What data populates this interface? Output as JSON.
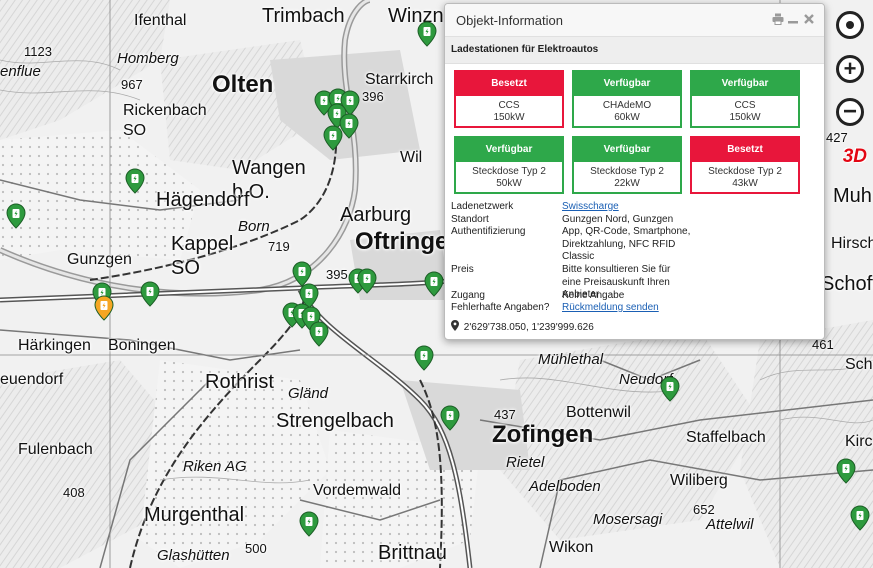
{
  "map": {
    "place_labels": [
      {
        "text": "Trimbach",
        "cls": "lbl-mid"
      },
      {
        "text": "Winzna",
        "cls": "lbl-mid"
      },
      {
        "text": "Ifenthal",
        "cls": "lbl-sm"
      },
      {
        "text": "Homberg",
        "cls": "lbl-it"
      },
      {
        "text": "Olten",
        "cls": "lbl-big"
      },
      {
        "text": "Starrkirch",
        "cls": "lbl-sm"
      },
      {
        "text": "Rickenbach SO",
        "cls": "lbl-sm"
      },
      {
        "text": "Wangen b.O.",
        "cls": "lbl-mid"
      },
      {
        "text": "Wil",
        "cls": "lbl-sm"
      },
      {
        "text": "Hägendorf",
        "cls": "lbl-mid"
      },
      {
        "text": "Aarburg",
        "cls": "lbl-mid"
      },
      {
        "text": "Oftringen",
        "cls": "lbl-big"
      },
      {
        "text": "Kappel SO",
        "cls": "lbl-mid"
      },
      {
        "text": "Born",
        "cls": "lbl-it"
      },
      {
        "text": "Gunzgen",
        "cls": "lbl-sm"
      },
      {
        "text": "Härkingen",
        "cls": "lbl-sm"
      },
      {
        "text": "Boningen",
        "cls": "lbl-sm"
      },
      {
        "text": "euendorf",
        "cls": "lbl-sm"
      },
      {
        "text": "Rothrist",
        "cls": "lbl-mid"
      },
      {
        "text": "Gländ",
        "cls": "lbl-it"
      },
      {
        "text": "Strengelbach",
        "cls": "lbl-mid"
      },
      {
        "text": "Mühlethal",
        "cls": "lbl-it"
      },
      {
        "text": "Neudorf",
        "cls": "lbl-it"
      },
      {
        "text": "Bottenwil",
        "cls": "lbl-sm"
      },
      {
        "text": "Zofingen",
        "cls": "lbl-big"
      },
      {
        "text": "Staffelbach",
        "cls": "lbl-sm"
      },
      {
        "text": "Fulenbach",
        "cls": "lbl-sm"
      },
      {
        "text": "Riken AG",
        "cls": "lbl-it"
      },
      {
        "text": "Rietel",
        "cls": "lbl-it"
      },
      {
        "text": "Adelboden",
        "cls": "lbl-it"
      },
      {
        "text": "Wiliberg",
        "cls": "lbl-sm"
      },
      {
        "text": "Murgenthal",
        "cls": "lbl-mid"
      },
      {
        "text": "Vordemwald",
        "cls": "lbl-sm"
      },
      {
        "text": "Mosersagi",
        "cls": "lbl-it"
      },
      {
        "text": "Attelwil",
        "cls": "lbl-it"
      },
      {
        "text": "Glashütten",
        "cls": "lbl-it"
      },
      {
        "text": "Wikon",
        "cls": "lbl-sm"
      },
      {
        "text": "Brittnau",
        "cls": "lbl-mid"
      },
      {
        "text": "Muh",
        "cls": "lbl-mid"
      },
      {
        "text": "Hirsch",
        "cls": "lbl-sm"
      },
      {
        "text": "Schoft",
        "cls": "lbl-mid"
      },
      {
        "text": "Schlo",
        "cls": "lbl-sm"
      },
      {
        "text": "Kirc",
        "cls": "lbl-sm"
      },
      {
        "text": "enflue",
        "cls": "lbl-it"
      }
    ],
    "elevation_labels": [
      "1123",
      "967",
      "396",
      "719",
      "395",
      "437",
      "408",
      "652",
      "500",
      "461",
      "427"
    ],
    "charger_marker_count": 27
  },
  "controls": {
    "locate_icon": "target-icon",
    "zoom_in": "+",
    "zoom_out": "−",
    "view_3d": "3D"
  },
  "popup": {
    "title": "Objekt-Information",
    "subtitle": "Ladestationen für Elektroautos",
    "connectors": [
      {
        "status": "Besetzt",
        "type": "CCS",
        "power": "150kW",
        "color": "#e8163b"
      },
      {
        "status": "Verfügbar",
        "type": "CHAdeMO",
        "power": "60kW",
        "color": "#2ea84a"
      },
      {
        "status": "Verfügbar",
        "type": "CCS",
        "power": "150kW",
        "color": "#2ea84a"
      },
      {
        "status": "Verfügbar",
        "type": "Steckdose Typ 2",
        "power": "50kW",
        "color": "#2ea84a"
      },
      {
        "status": "Verfügbar",
        "type": "Steckdose Typ 2",
        "power": "22kW",
        "color": "#2ea84a"
      },
      {
        "status": "Besetzt",
        "type": "Steckdose Typ 2",
        "power": "43kW",
        "color": "#e8163b"
      }
    ],
    "info": {
      "network_label": "Ladenetzwerk",
      "network_value": "Swisscharge",
      "location_label": "Standort",
      "location_value": "Gunzgen Nord, Gunzgen",
      "auth_label": "Authentifizierung",
      "auth_value": "App, QR-Code, Smartphone, Direktzahlung, NFC RFID Classic",
      "price_label": "Preis",
      "price_value": "Bitte konsultieren Sie für eine Preisauskunft Ihren Anbieter",
      "access_label": "Zugang",
      "access_value": "Keine Angabe",
      "error_label": "Fehlerhafte Angaben?",
      "error_value": "Rückmeldung senden"
    },
    "coordinates": "2'629'738.050, 1'239'999.626"
  },
  "colors": {
    "available": "#2ea84a",
    "occupied": "#e8163b",
    "marker": "#2e9a3e",
    "selected_marker": "#f5a623",
    "link": "#1a5fb4"
  }
}
